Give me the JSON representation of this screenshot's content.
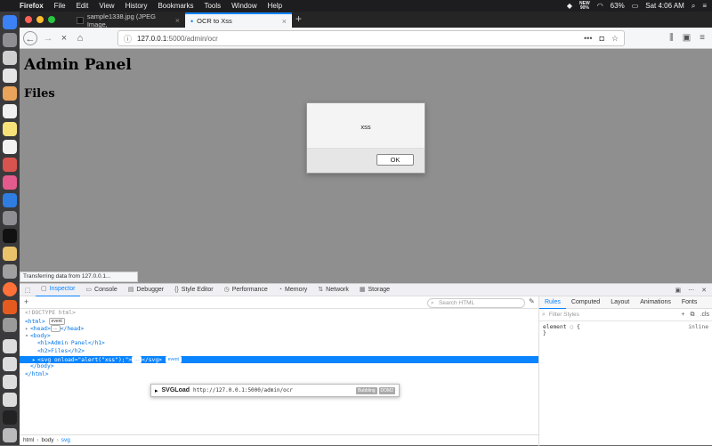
{
  "menubar": {
    "apple": "",
    "items": [
      "Firefox",
      "File",
      "Edit",
      "View",
      "History",
      "Bookmarks",
      "Tools",
      "Window",
      "Help"
    ],
    "network_badge_top": "NEW",
    "network_badge_bottom": "90%",
    "battery": "63%",
    "clock": "Sat 4:06 AM"
  },
  "tabs": [
    {
      "label": "sample1338.jpg (JPEG Image,",
      "close": "×"
    },
    {
      "label": "OCR to Xss",
      "close": "×"
    }
  ],
  "new_tab": "+",
  "nav": {
    "back": "←",
    "forward": "→",
    "stop": "×",
    "home": "⌂",
    "url_host": "127.0.0.1",
    "url_path": ":5000/admin/ocr",
    "more": "•••"
  },
  "page": {
    "h1": "Admin Panel",
    "h2": "Files",
    "alert_message": "xss",
    "alert_ok": "OK",
    "status": "Transferring data from 127.0.0.1..."
  },
  "devtools": {
    "tabs": [
      "Inspector",
      "Console",
      "Debugger",
      "Style Editor",
      "Performance",
      "Memory",
      "Network",
      "Storage"
    ],
    "search_placeholder": "Search HTML",
    "tree": {
      "doctype": "<!DOCTYPE html>",
      "html_open": "<html>",
      "head": "<head>",
      "head_close": "</head>",
      "body_open": "<body>",
      "h1": "<h1>Admin Panel</h1>",
      "h2": "<h2>Files</h2>",
      "svg_open": "<svg ",
      "svg_attr": "onload=\"alert(\"xss\");\"",
      "svg_close": "</svg>",
      "body_close": "</body>",
      "html_close": "</html>",
      "event_badge": "event",
      "collapsed": "…"
    },
    "tooltip": {
      "event": "SVGLoad",
      "url": "http://127.0.0.1:5000/admin/ocr",
      "chip1": "Bubbling",
      "chip2": "DOM2"
    },
    "breadcrumb": [
      "html",
      "body",
      "svg"
    ],
    "sidebar_tabs": [
      "Rules",
      "Computed",
      "Layout",
      "Animations",
      "Fonts"
    ],
    "filter_placeholder": "Filter Styles",
    "rule_selector": "element",
    "rule_brace_open": "{",
    "rule_brace_close": "}",
    "rule_source": "inline",
    "cls": ".cls"
  },
  "colors": {
    "accent": "#0a84ff",
    "page_bg": "#8f8f8f",
    "menubar_bg": "#1d1d1f"
  }
}
